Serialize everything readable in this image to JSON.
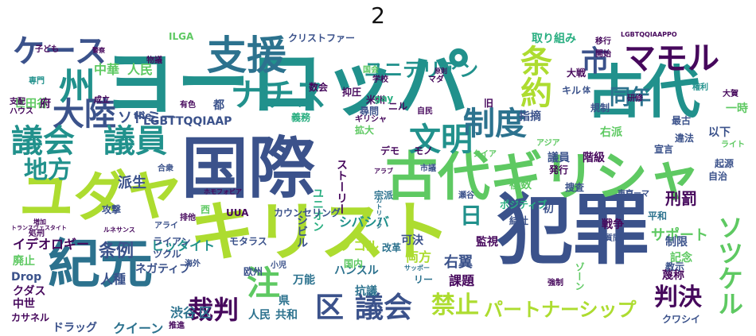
{
  "title": "2",
  "palette": {
    "purple": "#46085c",
    "indigo": "#3b528b",
    "blue": "#2c728e",
    "teal": "#21918c",
    "green": "#28ae80",
    "lime": "#5ec962",
    "yellow": "#addc30",
    "gold": "#d5e21a"
  },
  "words": [
    "国際",
    "キリスト",
    "ヨーロッパ",
    "犯罪",
    "古代ギリシャ",
    "ユダヤ",
    "紀元",
    "古代",
    "支援",
    "ナチス",
    "ケース",
    "州",
    "大陸",
    "議会",
    "議員",
    "文明",
    "制度",
    "市",
    "マモル",
    "条約",
    "同年",
    "地方",
    "判決",
    "区",
    "議会",
    "裁判",
    "注",
    "禁止",
    "パートナーシップ",
    "日",
    "ソツケル",
    "ユニテリアン",
    "中華",
    "人民",
    "派生",
    "世田谷",
    "ソドミー",
    "刑罰",
    "サポート",
    "条例",
    "イデオロギー",
    "ヒッタイト",
    "人種",
    "渋谷",
    "区",
    "ドラッグ",
    "クイーン",
    "ノコル",
    "シバシバ",
    "右翼",
    "ハンスル",
    "課題",
    "両方",
    "抗議",
    "万能",
    "人民",
    "共和",
    "県",
    "中世",
    "カサネル",
    "LGBTTQQIAAP",
    "the",
    "マダ",
    "米州",
    "義務",
    "gay",
    "宗派",
    "可決",
    "監視",
    "記念",
    "蔑称",
    "制限",
    "平和",
    "自治",
    "宣言",
    "違法",
    "最古",
    "以下",
    "右派",
    "階級",
    "指摘",
    "議員",
    "発行",
    "捜査",
    "質問",
    "東京",
    "戦争",
    "強制",
    "初",
    "ポジティブ",
    "複数",
    "結社",
    "瀬谷",
    "アジア",
    "クイア",
    "ゾーン",
    "シビル",
    "ユニオン",
    "ストーリー",
    "ネガティブ",
    "ライアン",
    "ツクル",
    "海外",
    "欧州",
    "小児",
    "モタラス",
    "カウンセリング",
    "UUA",
    "西",
    "排他",
    "アライ",
    "攻撃",
    "合衆",
    "処刑",
    "増加",
    "廃止",
    "Drop",
    "クダス",
    "トランスヴェスタイト",
    "支配",
    "ハウス",
    "専門",
    "子ども",
    "警察",
    "成立",
    "ILGA",
    "大戦",
    "移行",
    "開始",
    "大賀",
    "起源",
    "ライト",
    "教示",
    "クワシイ",
    "リー",
    "国内",
    "改革",
    "サッポー",
    "推進",
    "旧",
    "自民",
    "ギリシャ",
    "拡大",
    "デモ",
    "モノ",
    "アラブ",
    "市議",
    "カトリック",
    "数会",
    "抑圧",
    "国会",
    "学校",
    "原則",
    "権利",
    "一時",
    "研修",
    "規制",
    "体",
    "キル",
    "ホモフォビア",
    "尋問",
    "ニル",
    "都",
    "府",
    "物議",
    "有色",
    "クリストファー",
    "LGBTQQIAAPPO",
    "ルネサンス",
    "取り組み",
    "ローマ"
  ]
}
